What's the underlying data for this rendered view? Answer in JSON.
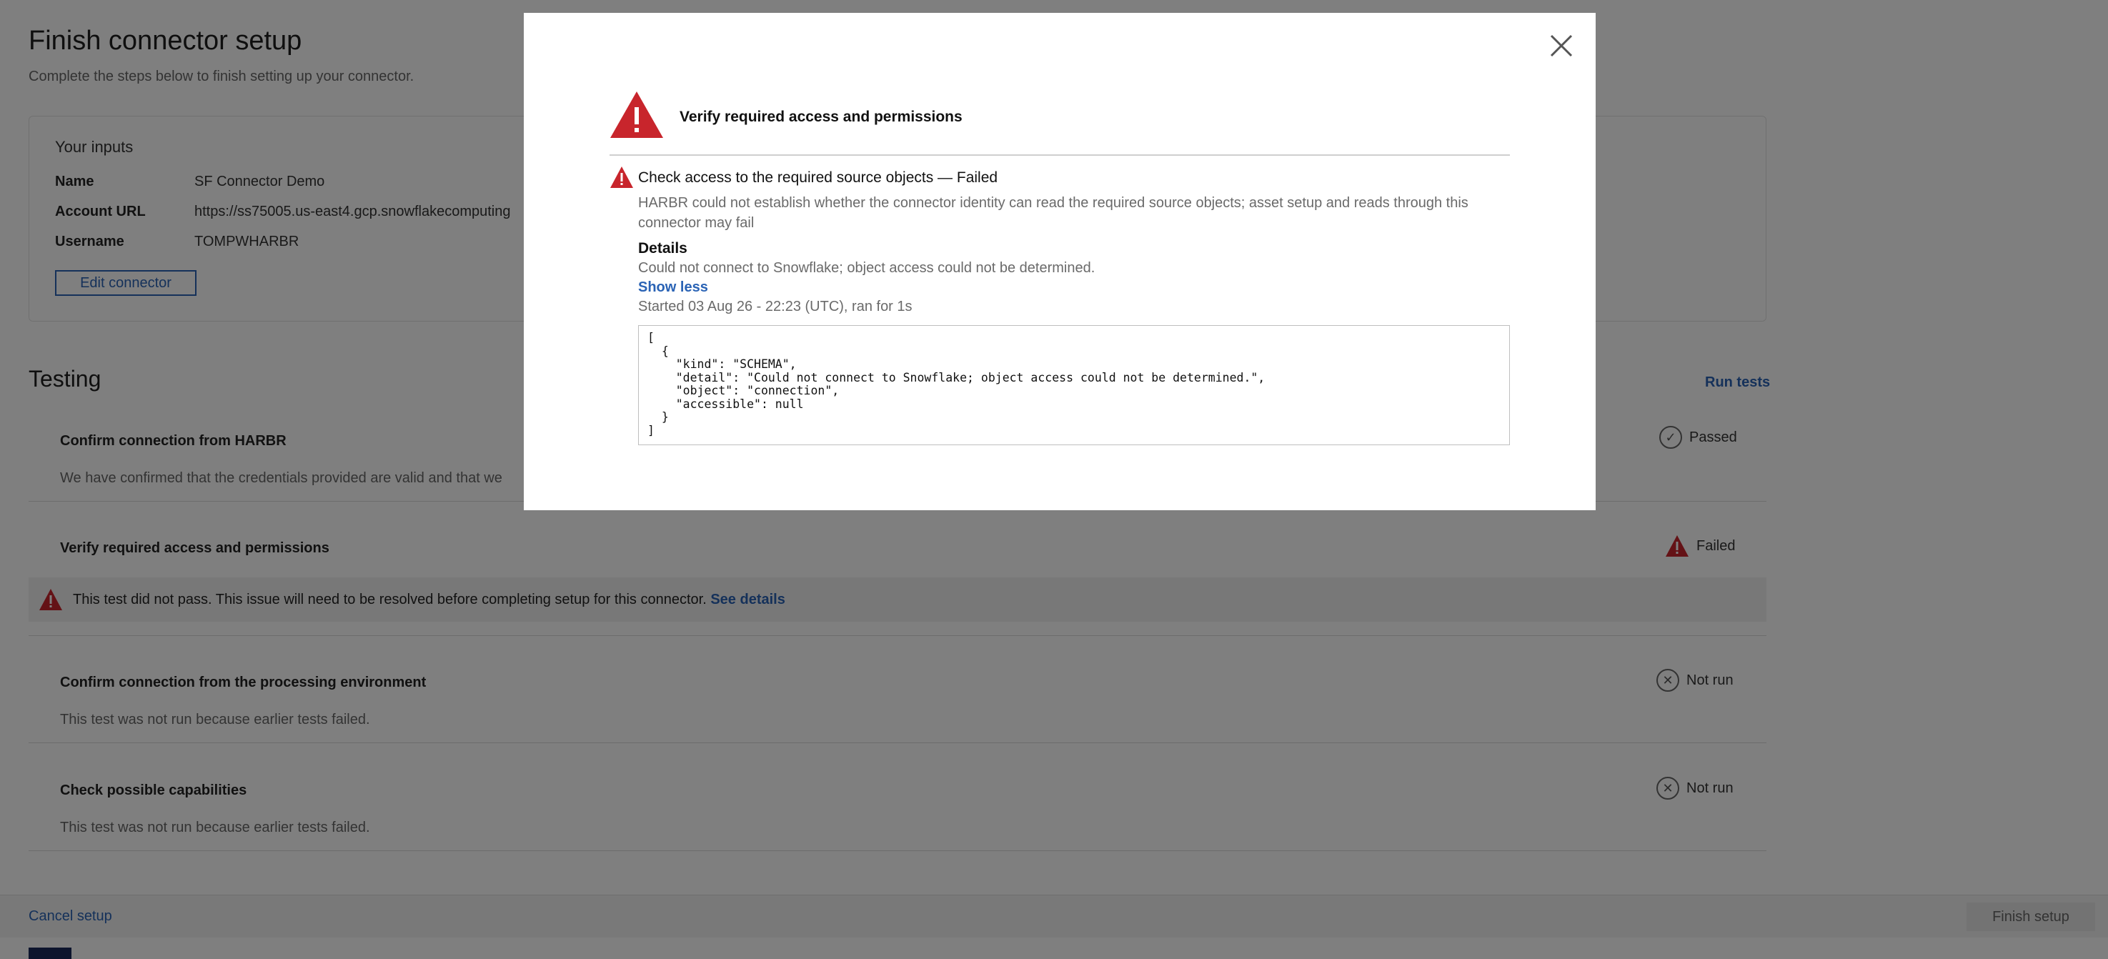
{
  "page": {
    "title": "Finish connector setup",
    "subtitle": "Complete the steps below to finish setting up your connector."
  },
  "inputs": {
    "heading": "Your inputs",
    "rows": [
      {
        "label": "Name",
        "value": "SF Connector Demo"
      },
      {
        "label": "Account URL",
        "value": "https://ss75005.us-east4.gcp.snowflakecomputing"
      },
      {
        "label": "Username",
        "value": "TOMPWHARBR"
      }
    ],
    "edit_label": "Edit connector"
  },
  "testing": {
    "title": "Testing",
    "run_label": "Run tests",
    "tests": [
      {
        "title": "Confirm connection from HARBR",
        "desc": "We have confirmed that the credentials provided are valid and that we",
        "status": "Passed"
      },
      {
        "title": "Verify required access and permissions",
        "status": "Failed",
        "banner": "This test did not pass. This issue will need to be resolved before completing setup for this connector.",
        "banner_link": "See details"
      },
      {
        "title": "Confirm connection from the processing environment",
        "desc": "This test was not run because earlier tests failed.",
        "status": "Not run"
      },
      {
        "title": "Check possible capabilities",
        "desc": "This test was not run because earlier tests failed.",
        "status": "Not run"
      }
    ]
  },
  "footer": {
    "cancel_label": "Cancel setup",
    "finish_label": "Finish setup"
  },
  "modal": {
    "title": "Verify required access and permissions",
    "check_title": "Check access to the required source objects — Failed",
    "check_desc": "HARBR could not establish whether the connector identity can read the required source objects; asset setup and reads through this connector may fail",
    "details_label": "Details",
    "details_text": "Could not connect to Snowflake; object access could not be determined.",
    "show_less_label": "Show less",
    "started_text": "Started 03 Aug 26 - 22:23 (UTC), ran for 1s",
    "code": "[\n  {\n    \"kind\": \"SCHEMA\",\n    \"detail\": \"Could not connect to Snowflake; object access could not be determined.\",\n    \"object\": \"connection\",\n    \"accessible\": null\n  }\n]"
  },
  "colors": {
    "accent": "#2a63b5",
    "error": "#c8252c",
    "overlay": "rgba(0,0,0,0.5)"
  }
}
